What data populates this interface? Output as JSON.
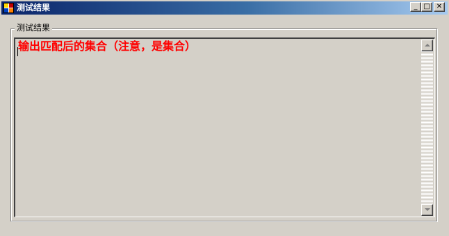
{
  "window": {
    "title": "测试结果",
    "minimize_glyph": "_",
    "maximize_glyph": "□",
    "close_glyph": "✕"
  },
  "groupbox": {
    "label": "测试结果"
  },
  "textbox": {
    "value": "输出匹配后的集合（注意，是集合）",
    "text_color": "#ff0000"
  },
  "colors": {
    "titlebar_start": "#0a246a",
    "titlebar_end": "#a6caf0",
    "face": "#d4d0c8"
  }
}
